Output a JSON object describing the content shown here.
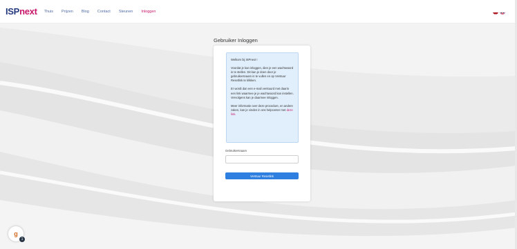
{
  "header": {
    "logo_part1": "ISP",
    "logo_part2": "next",
    "nav": [
      {
        "label": "Thuis"
      },
      {
        "label": "Prijzen"
      },
      {
        "label": "Blog"
      },
      {
        "label": "Contact"
      },
      {
        "label": "Steunen"
      },
      {
        "label": "Inloggen"
      }
    ],
    "active_nav_index": 5,
    "languages": [
      {
        "icon": "flag-nl-icon"
      },
      {
        "icon": "flag-uk-icon"
      }
    ]
  },
  "login": {
    "title": "Gebruiker Inloggen",
    "info": {
      "p1": "Welkom bij ISPnext !",
      "p2": "Voordat je kan inloggen, dien je een wachtwoord in te stellen. Dit kan je doen door je gebruikersnaam in te vullen en op Verstuur Resetlink te klikken.",
      "p3": "Er wordt dan een e-mail verstuurd met daarin een link waarmee je je wachtwoord kan instellen. Vervolgens kan je daarmee inloggen.",
      "p4_text": "Meer informatie over deze procedure, en andere zaken, kan je vinden in ons helpcenter met",
      "p4_link": "deze link."
    },
    "username_label": "Gebruikersnaam",
    "username_value": "",
    "submit_label": "Verstuur Resetlink"
  },
  "widget": {
    "icon": "support-widget-icon",
    "glyph": "g",
    "badge": "1"
  },
  "colors": {
    "brand_blue": "#253a7d",
    "brand_pink": "#c8176a",
    "button_blue": "#2f7fe0",
    "info_bg": "#e1eefb"
  }
}
